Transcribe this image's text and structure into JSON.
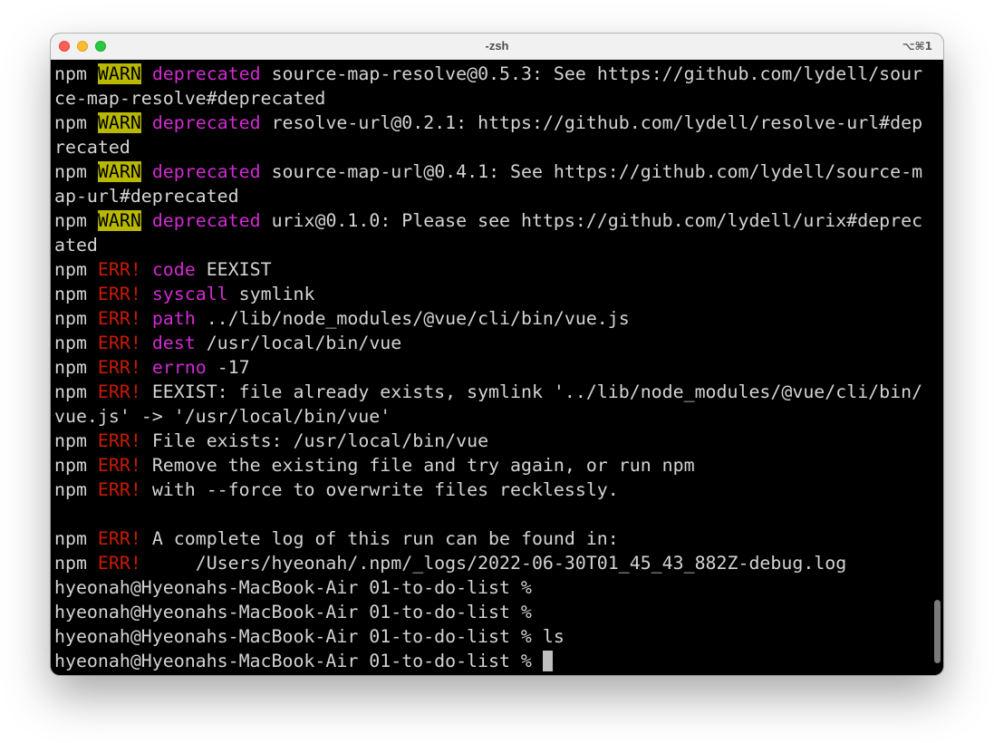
{
  "window": {
    "title": "-zsh",
    "shortcut": "⌥⌘1"
  },
  "terminal": {
    "lines": [
      {
        "p": "npm",
        "t": "WARN",
        "k": "deprecated",
        "m": "source-map-resolve@0.5.3: See https://github.com/lydell/sour"
      },
      {
        "m": "ce-map-resolve#deprecated"
      },
      {
        "p": "npm",
        "t": "WARN",
        "k": "deprecated",
        "m": "resolve-url@0.2.1: https://github.com/lydell/resolve-url#dep"
      },
      {
        "m": "recated"
      },
      {
        "p": "npm",
        "t": "WARN",
        "k": "deprecated",
        "m": "source-map-url@0.4.1: See https://github.com/lydell/source-m"
      },
      {
        "m": "ap-url#deprecated"
      },
      {
        "p": "npm",
        "t": "WARN",
        "k": "deprecated",
        "m": "urix@0.1.0: Please see https://github.com/lydell/urix#deprec"
      },
      {
        "m": "ated"
      },
      {
        "p": "npm",
        "e": "ERR!",
        "k": "code",
        "m": "EEXIST"
      },
      {
        "p": "npm",
        "e": "ERR!",
        "k": "syscall",
        "m": "symlink"
      },
      {
        "p": "npm",
        "e": "ERR!",
        "k": "path",
        "m": "../lib/node_modules/@vue/cli/bin/vue.js"
      },
      {
        "p": "npm",
        "e": "ERR!",
        "k": "dest",
        "m": "/usr/local/bin/vue"
      },
      {
        "p": "npm",
        "e": "ERR!",
        "k": "errno",
        "m": "-17"
      },
      {
        "p": "npm",
        "e": "ERR!",
        "m": "EEXIST: file already exists, symlink '../lib/node_modules/@vue/cli/bin/"
      },
      {
        "m": "vue.js' -> '/usr/local/bin/vue'"
      },
      {
        "p": "npm",
        "e": "ERR!",
        "m": "File exists: /usr/local/bin/vue"
      },
      {
        "p": "npm",
        "e": "ERR!",
        "m": "Remove the existing file and try again, or run npm"
      },
      {
        "p": "npm",
        "e": "ERR!",
        "m": "with --force to overwrite files recklessly."
      },
      {
        "m": ""
      },
      {
        "p": "npm",
        "e": "ERR!",
        "m": "A complete log of this run can be found in:"
      },
      {
        "p": "npm",
        "e": "ERR!",
        "m": "    /Users/hyeonah/.npm/_logs/2022-06-30T01_45_43_882Z-debug.log"
      },
      {
        "m": "hyeonah@Hyeonahs-MacBook-Air 01-to-do-list %"
      },
      {
        "m": "hyeonah@Hyeonahs-MacBook-Air 01-to-do-list %"
      },
      {
        "m": "hyeonah@Hyeonahs-MacBook-Air 01-to-do-list % ls"
      },
      {
        "m": "hyeonah@Hyeonahs-MacBook-Air 01-to-do-list % ",
        "cursor": true
      }
    ]
  },
  "colors": {
    "background": "#000000",
    "text": "#d4d4d4",
    "warn_bg": "#b8b800",
    "error": "#c91b00",
    "keyword": "#d12ad1"
  },
  "icons": [
    "close-button-icon",
    "minimize-button-icon",
    "zoom-button-icon"
  ]
}
